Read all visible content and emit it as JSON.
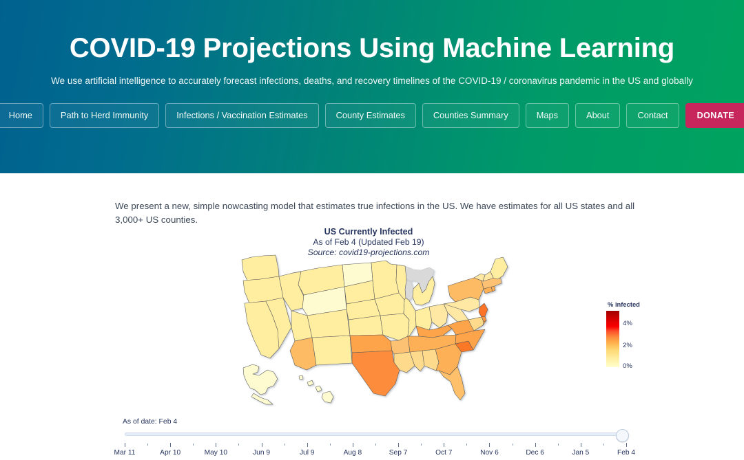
{
  "header": {
    "title": "COVID-19 Projections Using Machine Learning",
    "subtitle": "We use artificial intelligence to accurately forecast infections, deaths, and recovery timelines of the COVID-19 / coronavirus pandemic in the US and globally",
    "gradient_start": "#00618f",
    "gradient_end": "#00a35f",
    "nav": [
      {
        "label": "Home"
      },
      {
        "label": "Path to Herd Immunity"
      },
      {
        "label": "Infections / Vaccination Estimates"
      },
      {
        "label": "County Estimates"
      },
      {
        "label": "Counties Summary"
      },
      {
        "label": "Maps"
      },
      {
        "label": "About"
      },
      {
        "label": "Contact"
      },
      {
        "label": "DONATE",
        "accent": "#c6265b"
      }
    ]
  },
  "main": {
    "intro": "We present a new, simple nowcasting model that estimates true infections in the US. We have estimates for all US states and all 3,000+ US counties."
  },
  "slider": {
    "as_of_label": "As of date: Feb 4",
    "value": "Feb 4",
    "ticks": [
      "Mar 11",
      "Apr 10",
      "May 10",
      "Jun 9",
      "Jul 9",
      "Aug 8",
      "Sep 7",
      "Oct 7",
      "Nov 6",
      "Dec 6",
      "Jan 5",
      "Feb 4"
    ]
  },
  "chart_data": {
    "type": "heatmap",
    "subtype": "choropleth-map",
    "title": "US Currently Infected",
    "subtitle": "As of Feb 4 (Updated Feb 19)",
    "source": "Source: covid19-projections.com",
    "legend_title": "% infected",
    "legend_ticks": [
      "4%",
      "2%",
      "0%"
    ],
    "value_range": [
      0,
      4
    ],
    "unit": "%",
    "colorscale": [
      "#ffffcc",
      "#ffeda0",
      "#fed976",
      "#feb24c",
      "#fd8d3c",
      "#fc4e2a",
      "#e31a1c",
      "#bd0026",
      "#800026"
    ],
    "no_data_color": "#d9d9d9",
    "regions": [
      {
        "id": "WA",
        "name": "Washington",
        "value": 0.55
      },
      {
        "id": "OR",
        "name": "Oregon",
        "value": 0.5
      },
      {
        "id": "CA",
        "name": "California",
        "value": 1.0
      },
      {
        "id": "NV",
        "name": "Nevada",
        "value": 1.05
      },
      {
        "id": "ID",
        "name": "Idaho",
        "value": 0.85
      },
      {
        "id": "MT",
        "name": "Montana",
        "value": 0.6
      },
      {
        "id": "WY",
        "name": "Wyoming",
        "value": 0.45
      },
      {
        "id": "UT",
        "name": "Utah",
        "value": 1.2
      },
      {
        "id": "AZ",
        "name": "Arizona",
        "value": 1.7
      },
      {
        "id": "CO",
        "name": "Colorado",
        "value": 0.8
      },
      {
        "id": "NM",
        "name": "New Mexico",
        "value": 0.85
      },
      {
        "id": "ND",
        "name": "North Dakota",
        "value": 0.35
      },
      {
        "id": "SD",
        "name": "South Dakota",
        "value": 0.5
      },
      {
        "id": "NE",
        "name": "Nebraska",
        "value": 0.6
      },
      {
        "id": "KS",
        "name": "Kansas",
        "value": 0.8
      },
      {
        "id": "OK",
        "name": "Oklahoma",
        "value": 1.5
      },
      {
        "id": "TX",
        "name": "Texas",
        "value": 2.3
      },
      {
        "id": "MN",
        "name": "Minnesota",
        "value": 0.45
      },
      {
        "id": "IA",
        "name": "Iowa",
        "value": 0.65
      },
      {
        "id": "MO",
        "name": "Missouri",
        "value": 0.8
      },
      {
        "id": "AR",
        "name": "Arkansas",
        "value": 1.4
      },
      {
        "id": "LA",
        "name": "Louisiana",
        "value": 0.9
      },
      {
        "id": "WI",
        "name": "Wisconsin",
        "value": 0.55
      },
      {
        "id": "IL",
        "name": "Illinois",
        "value": 0.8
      },
      {
        "id": "MS",
        "name": "Mississippi",
        "value": 1.1
      },
      {
        "id": "AL",
        "name": "Alabama",
        "value": 1.1
      },
      {
        "id": "MI",
        "name": "Michigan",
        "value": 0.55
      },
      {
        "id": "IN",
        "name": "Indiana",
        "value": 0.85
      },
      {
        "id": "OH",
        "name": "Ohio",
        "value": 0.95
      },
      {
        "id": "KY",
        "name": "Kentucky",
        "value": 1.7
      },
      {
        "id": "TN",
        "name": "Tennessee",
        "value": 1.5
      },
      {
        "id": "GA",
        "name": "Georgia",
        "value": 1.5
      },
      {
        "id": "FL",
        "name": "Florida",
        "value": 1.3
      },
      {
        "id": "SC",
        "name": "South Carolina",
        "value": 2.6
      },
      {
        "id": "NC",
        "name": "North Carolina",
        "value": 1.6
      },
      {
        "id": "VA",
        "name": "Virginia",
        "value": 1.5
      },
      {
        "id": "WV",
        "name": "West Virginia",
        "value": 0.75
      },
      {
        "id": "PA",
        "name": "Pennsylvania",
        "value": 1.0
      },
      {
        "id": "NY",
        "name": "New York",
        "value": 1.8
      },
      {
        "id": "NJ",
        "name": "New Jersey",
        "value": 2.0
      },
      {
        "id": "DE",
        "name": "Delaware",
        "value": 1.7
      },
      {
        "id": "MD",
        "name": "Maryland",
        "value": 1.1
      },
      {
        "id": "CT",
        "name": "Connecticut",
        "value": 1.6
      },
      {
        "id": "RI",
        "name": "Rhode Island",
        "value": 1.5
      },
      {
        "id": "MA",
        "name": "Massachusetts",
        "value": 1.4
      },
      {
        "id": "VT",
        "name": "Vermont",
        "value": 0.7
      },
      {
        "id": "NH",
        "name": "New Hampshire",
        "value": 1.0
      },
      {
        "id": "ME",
        "name": "Maine",
        "value": 0.6
      },
      {
        "id": "AK",
        "name": "Alaska",
        "value": 0.5
      },
      {
        "id": "HI",
        "name": "Hawaii",
        "value": 0.4
      }
    ]
  }
}
